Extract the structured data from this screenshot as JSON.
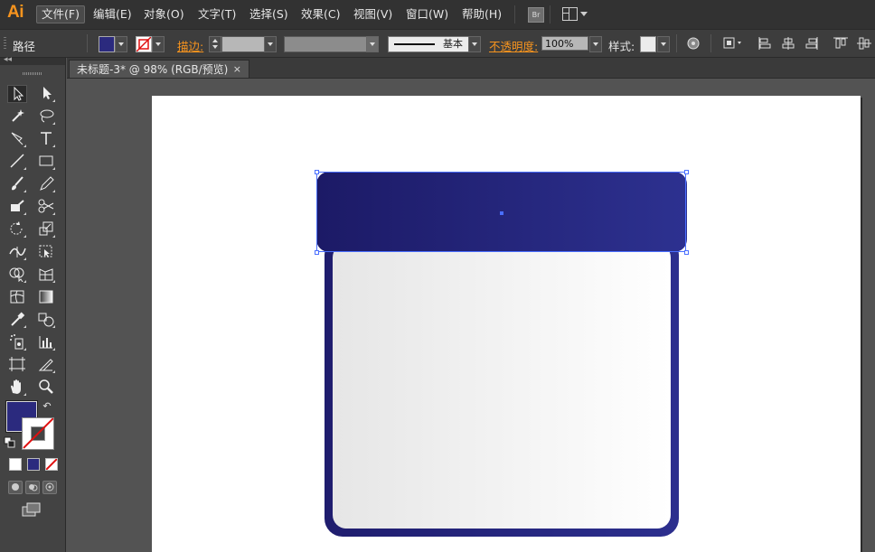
{
  "app": {
    "logo": "Ai"
  },
  "menubar": {
    "items": [
      "文件(F)",
      "编辑(E)",
      "对象(O)",
      "文字(T)",
      "选择(S)",
      "效果(C)",
      "视图(V)",
      "窗口(W)",
      "帮助(H)"
    ],
    "active": "文件(F)",
    "bridge_label": "Br"
  },
  "controlbar": {
    "selection_label": "路径",
    "fill_color": "#2b2a7e",
    "stroke_label": "描边:",
    "stroke_style_label": "基本",
    "opacity_label": "不透明度:",
    "opacity_value": "100%",
    "style_label": "样式:"
  },
  "document": {
    "tab_title": "未标题-3* @ 98% (RGB/预览)",
    "close_glyph": "×"
  },
  "tools": {
    "fill_color": "#2b2a7e",
    "stroke_color": "none"
  },
  "artwork": {
    "lid_gradient": [
      "#1c1a66",
      "#2d3190"
    ],
    "body_gradient": [
      "#1f1d6e",
      "#2c2f8e"
    ],
    "inner_gradient": [
      "#e6e6e6",
      "#ffffff"
    ]
  }
}
